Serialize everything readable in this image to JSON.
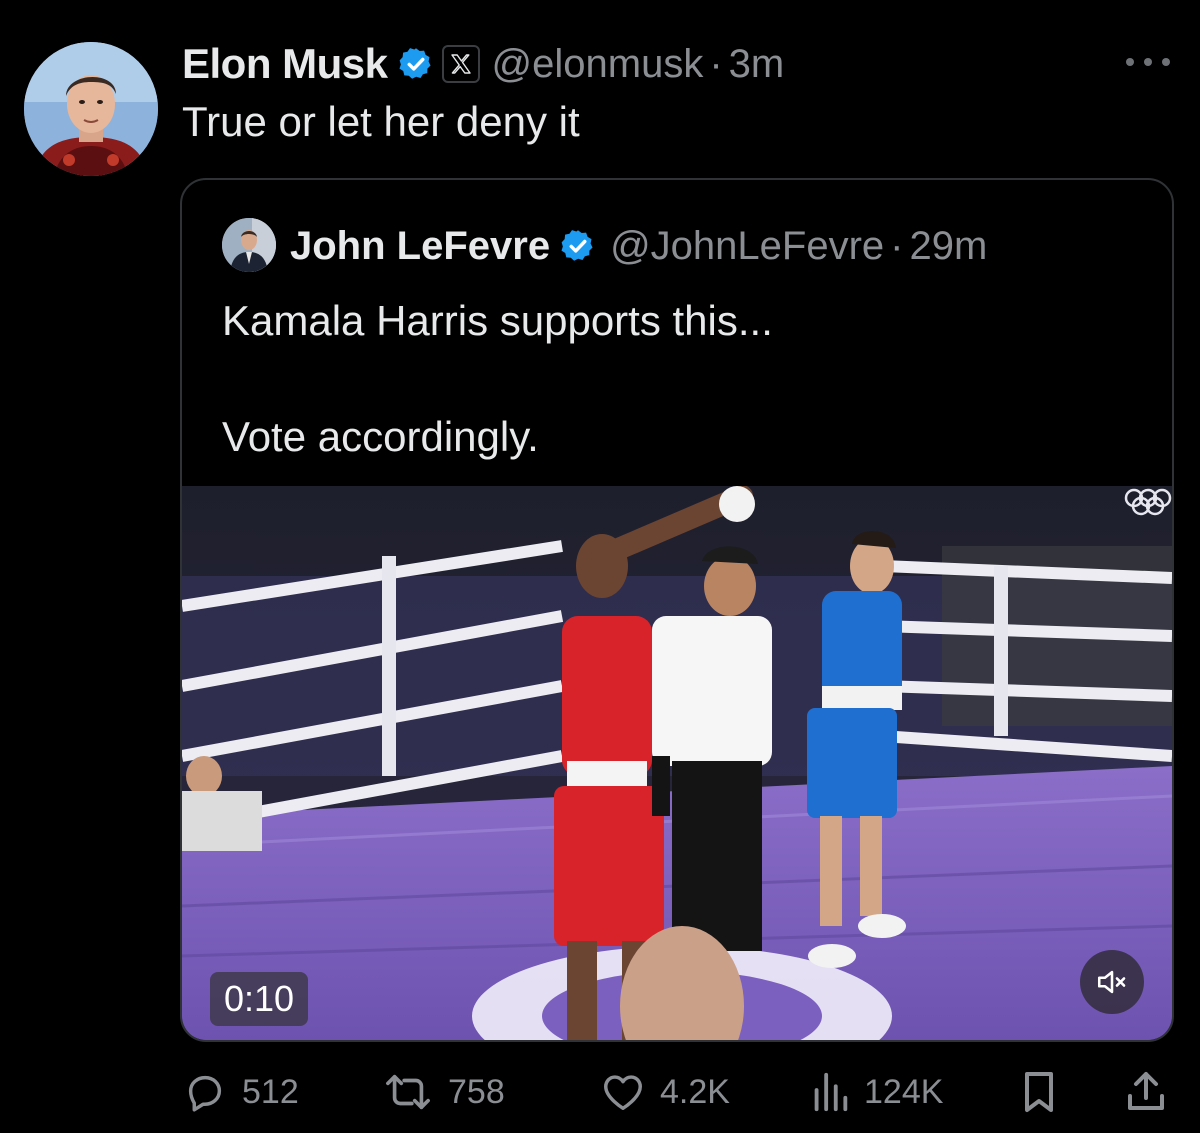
{
  "post": {
    "author_name": "Elon Musk",
    "handle": "@elonmusk",
    "separator": "·",
    "time": "3m",
    "text": "True or let her deny it"
  },
  "quote": {
    "author_name": "John LeFevre",
    "handle": "@JohnLeFevre",
    "separator": "·",
    "time": "29m",
    "text": "Kamala Harris supports this...\n\nVote accordingly.",
    "video": {
      "duration": "0:10",
      "muted": true
    }
  },
  "actions": {
    "replies": "512",
    "reposts": "758",
    "likes": "4.2K",
    "views": "124K"
  },
  "colors": {
    "background": "#000000",
    "text": "#e7e9ea",
    "muted_text": "#8b8f94",
    "verified": "#1d9bf0",
    "border": "#2f3336"
  },
  "icons": {
    "verified": "verified-badge-icon",
    "affiliation": "x-logo-icon",
    "more": "more-dots-icon",
    "reply": "reply-bubble-icon",
    "repost": "repost-arrows-icon",
    "like": "heart-icon",
    "views": "views-bars-icon",
    "bookmark": "bookmark-icon",
    "share": "share-upload-icon",
    "mute": "speaker-muted-icon"
  }
}
